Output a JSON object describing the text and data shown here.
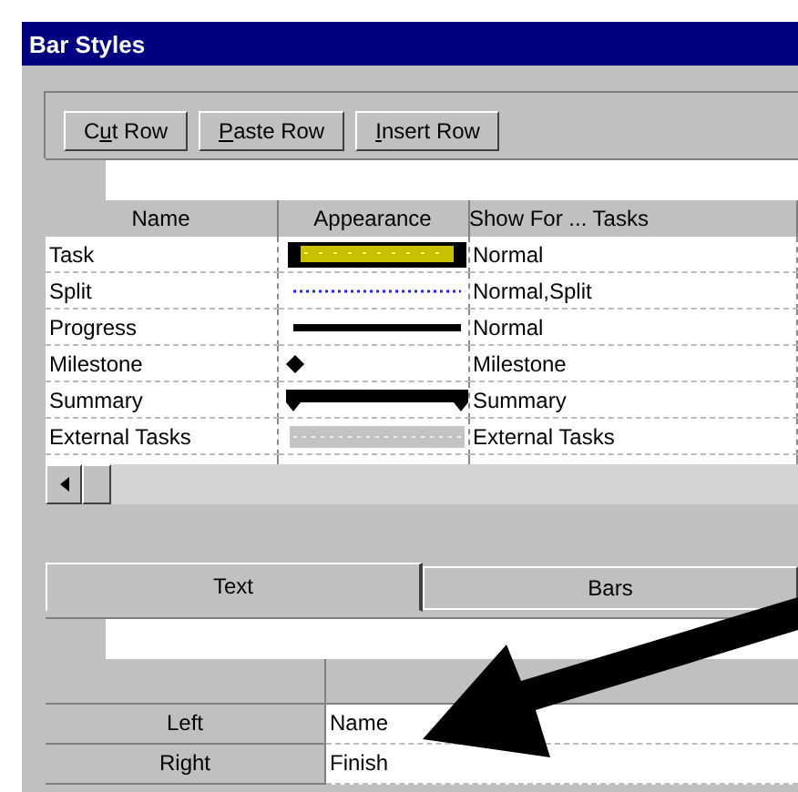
{
  "window": {
    "title": "Bar Styles"
  },
  "buttons": [
    {
      "label_before_key": "C",
      "access_key": "u",
      "label_after_key": "t Row"
    },
    {
      "access_key": "P",
      "label_after_key": "aste Row"
    },
    {
      "access_key": "I",
      "label_after_key": "nsert Row"
    }
  ],
  "table": {
    "columns": [
      "Name",
      "Appearance",
      "Show For ... Tasks"
    ],
    "rows": [
      {
        "name": "Task",
        "kind": "task",
        "show_for": "Normal"
      },
      {
        "name": "Split",
        "kind": "split",
        "show_for": "Normal,Split"
      },
      {
        "name": "Progress",
        "kind": "progress",
        "show_for": "Normal"
      },
      {
        "name": "Milestone",
        "kind": "milestone",
        "show_for": "Milestone"
      },
      {
        "name": "Summary",
        "kind": "summary",
        "show_for": "Summary"
      },
      {
        "name": "External Tasks",
        "kind": "external",
        "show_for": "External Tasks"
      }
    ]
  },
  "tabs": [
    {
      "label": "Text",
      "selected": true
    },
    {
      "label": "Bars",
      "selected": false
    }
  ],
  "text_grid": {
    "rows": [
      {
        "label": "Left",
        "value": "Name"
      },
      {
        "label": "Right",
        "value": "Finish"
      }
    ]
  }
}
